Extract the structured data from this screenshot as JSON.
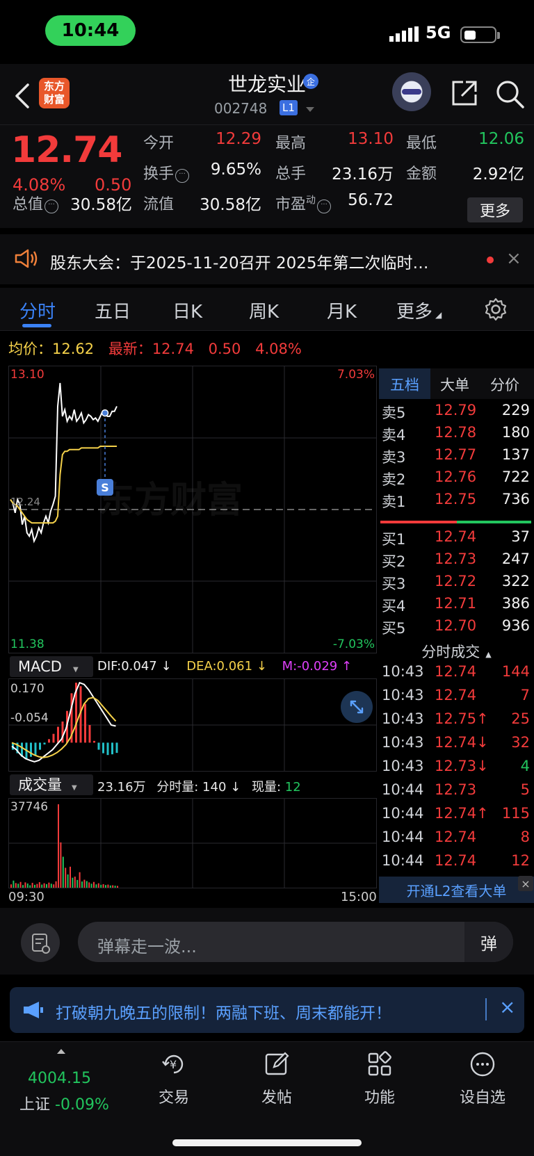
{
  "status_bar": {
    "time": "10:44",
    "network": "5G"
  },
  "header": {
    "logo_text": "东方\n财富",
    "stock_name": "世龙实业",
    "badge": "企",
    "stock_code": "002748",
    "level_badge": "L1"
  },
  "quote": {
    "last_price": "12.74",
    "pct_change": "4.08%",
    "abs_change": "0.50",
    "open_label": "今开",
    "open": "12.29",
    "high_label": "最高",
    "high": "13.10",
    "low_label": "最低",
    "low": "12.06",
    "turnover_label": "换手",
    "turnover": "9.65%",
    "volume_label": "总手",
    "volume": "23.16万",
    "amount_label": "金额",
    "amount": "2.92亿",
    "mktcap_label": "总值",
    "mktcap": "30.58亿",
    "float_label": "流值",
    "float_cap": "30.58亿",
    "pe_label": "市盈",
    "pe_sup": "动",
    "pe": "56.72",
    "more_label": "更多"
  },
  "notice": {
    "text": "股东大会：于2025-11-20召开 2025年第二次临时…",
    "close": "×"
  },
  "tabs": {
    "items": [
      "分时",
      "五日",
      "日K",
      "周K",
      "月K",
      "更多"
    ]
  },
  "avg_row": {
    "avg_label": "均价：",
    "avg": "12.62",
    "latest_label": "最新：",
    "latest": "12.74",
    "change": "0.50",
    "pct": "4.08%"
  },
  "chart_data": {
    "type": "line",
    "title": "",
    "x_start": "09:30",
    "x_end": "15:00",
    "ylim": [
      11.38,
      13.1
    ],
    "y_top_label": "13.10",
    "y_bottom_label": "11.38",
    "pct_top": "7.03%",
    "pct_bottom": "-7.03%",
    "prev_close_label": "12.24",
    "watermark": "东方财富",
    "marker_label": "S",
    "series": [
      {
        "name": "price",
        "color": "#ffffff",
        "values": [
          12.3,
          12.28,
          12.22,
          12.3,
          12.27,
          12.15,
          12.2,
          12.1,
          12.08,
          12.12,
          12.05,
          12.08,
          12.13,
          12.1,
          12.16,
          12.2,
          12.16,
          12.23,
          12.27,
          12.32,
          12.86,
          13.0,
          12.8,
          12.84,
          12.77,
          12.8,
          12.78,
          12.84,
          12.77,
          12.79,
          12.82,
          12.76,
          12.78,
          12.81,
          12.8,
          12.78,
          12.79,
          12.77,
          12.8,
          12.83,
          12.82,
          12.8,
          12.8,
          12.83,
          12.83,
          12.86
        ]
      },
      {
        "name": "average",
        "color": "#f6d24a",
        "values": [
          12.3,
          12.28,
          12.27,
          12.26,
          12.24,
          12.22,
          12.2,
          12.18,
          12.17,
          12.16,
          12.16,
          12.16,
          12.16,
          12.16,
          12.16,
          12.16,
          12.16,
          12.16,
          12.16,
          12.17,
          12.2,
          12.45,
          12.57,
          12.59,
          12.59,
          12.6,
          12.6,
          12.6,
          12.6,
          12.6,
          12.61,
          12.61,
          12.61,
          12.61,
          12.61,
          12.61,
          12.61,
          12.61,
          12.62,
          12.62,
          12.62,
          12.62,
          12.62,
          12.62,
          12.62,
          12.62
        ]
      }
    ]
  },
  "macd": {
    "selector": "MACD",
    "dif_label": "DIF:0.047 ↓",
    "dea_label": "DEA:0.061 ↓",
    "m_label": "M:-0.029 ↑",
    "y_top": "0.170",
    "y_bottom": "-0.054",
    "dif": [
      -0.01,
      -0.02,
      -0.035,
      -0.045,
      -0.05,
      -0.054,
      -0.05,
      -0.04,
      -0.03,
      -0.02,
      -0.005,
      0.01,
      0.04,
      0.09,
      0.14,
      0.17,
      0.165,
      0.15,
      0.13,
      0.11,
      0.09,
      0.07,
      0.05,
      0.047
    ],
    "dea": [
      0.0,
      -0.005,
      -0.012,
      -0.02,
      -0.028,
      -0.035,
      -0.04,
      -0.042,
      -0.04,
      -0.035,
      -0.028,
      -0.018,
      -0.005,
      0.015,
      0.045,
      0.08,
      0.11,
      0.125,
      0.128,
      0.12,
      0.105,
      0.09,
      0.075,
      0.061
    ],
    "hist": [
      -0.02,
      -0.03,
      -0.04,
      -0.045,
      -0.04,
      -0.035,
      -0.02,
      -0.005,
      0.01,
      0.025,
      0.045,
      0.06,
      0.09,
      0.14,
      0.17,
      0.16,
      0.11,
      0.05,
      0.005,
      -0.02,
      -0.03,
      -0.035,
      -0.033,
      -0.029
    ]
  },
  "volume": {
    "selector": "成交量",
    "total": "23.16万",
    "minute_label": "分时量: 140 ↓",
    "now_label": "现量: ",
    "now_value": "12",
    "y_top": "37746",
    "x_start": "09:30",
    "x_end": "15:00",
    "bars": [
      1500,
      3200,
      2100,
      1800,
      2600,
      1200,
      2400,
      1900,
      1100,
      2200,
      1300,
      1700,
      2500,
      1400,
      2000,
      1600,
      2300,
      1800,
      1500,
      2900,
      37746,
      20500,
      14000,
      9000,
      6000,
      9500,
      4500,
      5000,
      3500,
      7000,
      2800,
      3600,
      3000,
      2400,
      1800,
      2600,
      1500,
      2000,
      1300,
      1600,
      1200,
      1400,
      1000,
      1100,
      900,
      800
    ],
    "bar_colors": [
      "r",
      "g",
      "r",
      "g",
      "r",
      "g",
      "r",
      "g",
      "g",
      "r",
      "g",
      "r",
      "r",
      "g",
      "r",
      "g",
      "r",
      "g",
      "r",
      "r",
      "r",
      "r",
      "g",
      "r",
      "g",
      "r",
      "g",
      "r",
      "g",
      "r",
      "g",
      "r",
      "g",
      "r",
      "g",
      "r",
      "g",
      "r",
      "g",
      "r",
      "g",
      "r",
      "g",
      "r",
      "g",
      "r"
    ]
  },
  "order_book": {
    "tabs": [
      "五档",
      "大单",
      "分价"
    ],
    "asks": [
      {
        "label": "卖5",
        "price": "12.79",
        "qty": "229"
      },
      {
        "label": "卖4",
        "price": "12.78",
        "qty": "180"
      },
      {
        "label": "卖3",
        "price": "12.77",
        "qty": "137"
      },
      {
        "label": "卖2",
        "price": "12.76",
        "qty": "722"
      },
      {
        "label": "卖1",
        "price": "12.75",
        "qty": "736"
      }
    ],
    "bids": [
      {
        "label": "买1",
        "price": "12.74",
        "qty": "37"
      },
      {
        "label": "买2",
        "price": "12.73",
        "qty": "247"
      },
      {
        "label": "买3",
        "price": "12.72",
        "qty": "322"
      },
      {
        "label": "买4",
        "price": "12.71",
        "qty": "386"
      },
      {
        "label": "买5",
        "price": "12.70",
        "qty": "936"
      }
    ],
    "ticks_header": "分时成交",
    "ticks": [
      {
        "time": "10:43",
        "price": "12.74",
        "vol": "144",
        "color": "red"
      },
      {
        "time": "10:43",
        "price": "12.74",
        "vol": "7",
        "color": "red"
      },
      {
        "time": "10:43",
        "price": "12.75↑",
        "vol": "25",
        "color": "red"
      },
      {
        "time": "10:43",
        "price": "12.74↓",
        "vol": "32",
        "color": "red"
      },
      {
        "time": "10:43",
        "price": "12.73↓",
        "vol": "4",
        "color": "green"
      },
      {
        "time": "10:44",
        "price": "12.73",
        "vol": "5",
        "color": "red"
      },
      {
        "time": "10:44",
        "price": "12.74↑",
        "vol": "115",
        "color": "red"
      },
      {
        "time": "10:44",
        "price": "12.74",
        "vol": "8",
        "color": "red"
      },
      {
        "time": "10:44",
        "price": "12.74",
        "vol": "12",
        "color": "red"
      }
    ],
    "l2_banner": "开通L2查看大单",
    "l2_close": "×"
  },
  "danmu": {
    "placeholder": "弹幕走一波...",
    "toggle": "弹"
  },
  "promo": {
    "text": "打破朝九晚五的限制！两融下班、周末都能开！",
    "close": "×"
  },
  "bottom_nav": {
    "index_value": "4004.15",
    "index_name": "上证",
    "index_change": "-0.09%",
    "items": [
      "交易",
      "发帖",
      "功能",
      "设自选"
    ]
  },
  "colors": {
    "up": "#f23b3b",
    "down": "#22c55e",
    "avg": "#f6d24a",
    "accent": "#3b82f6"
  }
}
